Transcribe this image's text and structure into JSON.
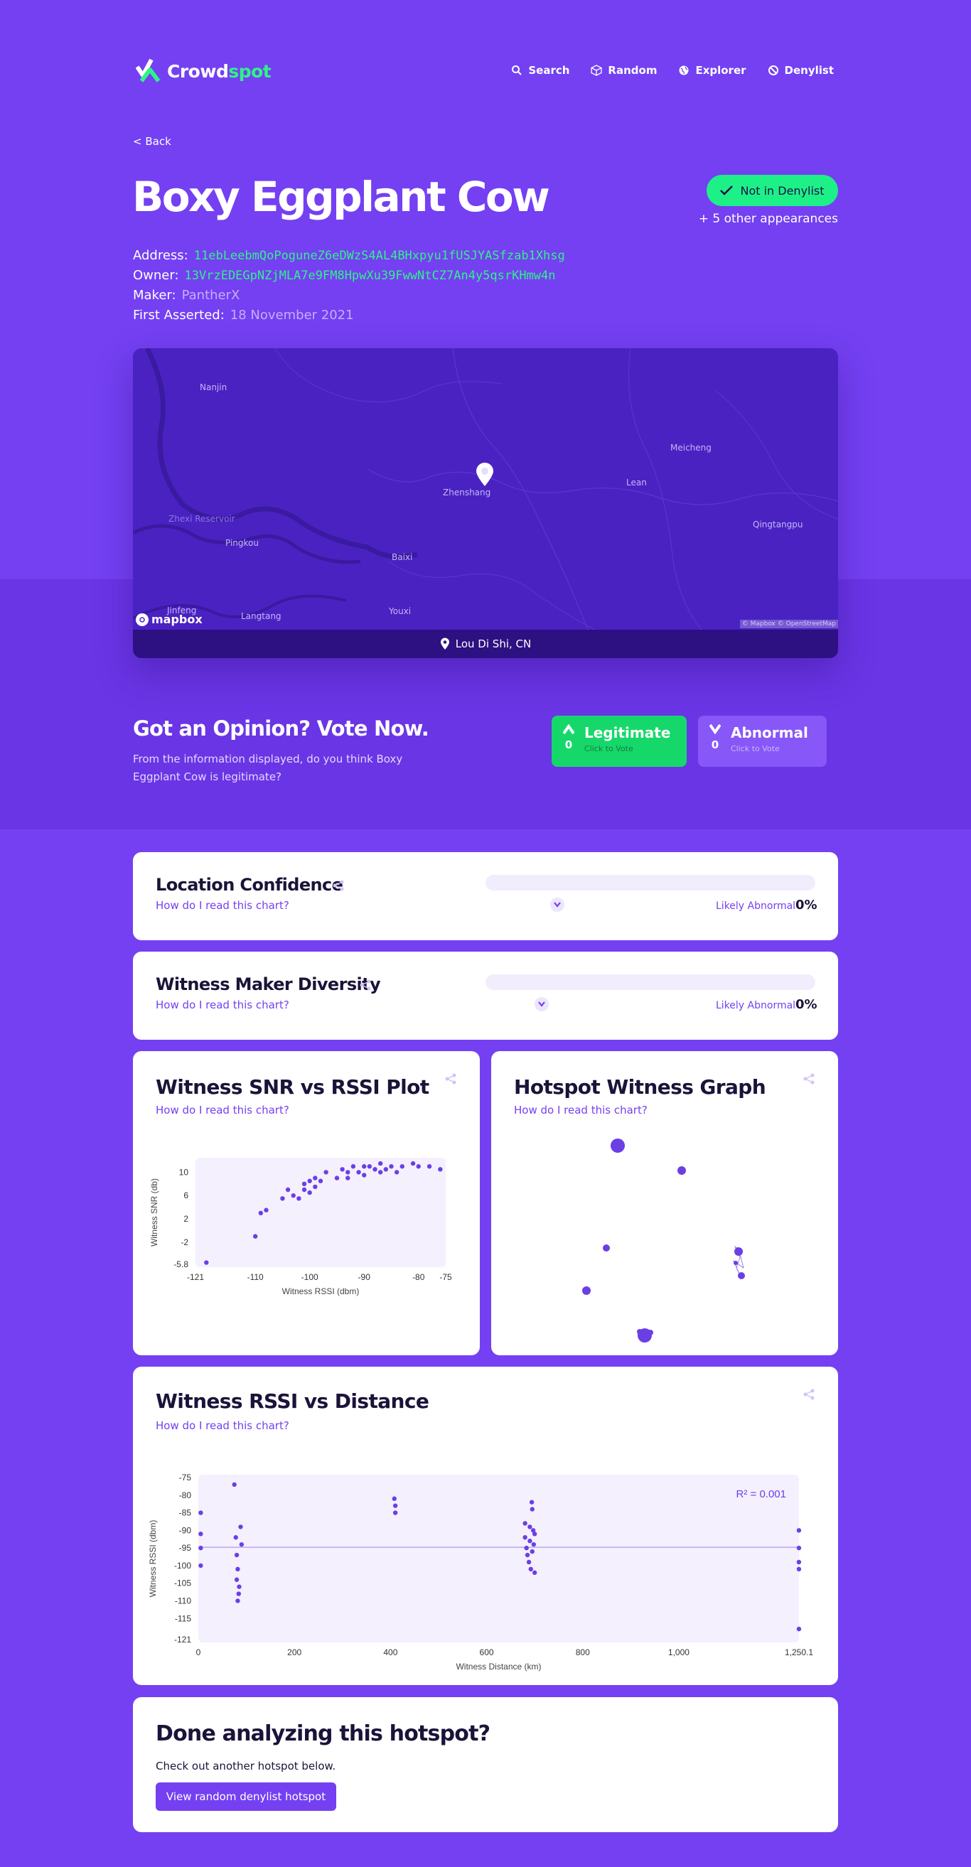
{
  "colors": {
    "brand": "#7440f2",
    "accent_green": "#1ef088",
    "card_bg": "#ffffff",
    "plot_bg": "#f4f0fe",
    "dot": "#6b3fe4"
  },
  "nav": {
    "logo_prefix": "Crowd",
    "logo_suffix": "spot",
    "links": [
      {
        "label": "Search",
        "icon": "search-icon"
      },
      {
        "label": "Random",
        "icon": "cube-icon"
      },
      {
        "label": "Explorer",
        "icon": "globe-icon"
      },
      {
        "label": "Denylist",
        "icon": "block-icon"
      }
    ]
  },
  "back_label": "< Back",
  "hotspot": {
    "name": "Boxy Eggplant Cow",
    "status": "Not in Denylist",
    "appearances": "+ 5 other appearances",
    "address_label": "Address:",
    "address": "11ebLeebmQoPoguneZ6eDWzS4AL4BHxpyu1fUSJYASfzab1Xhsg",
    "owner_label": "Owner:",
    "owner": "13VrzEDEGpNZjMLA7e9FM8HpwXu39FwwNtCZ7An4y5qsrKHmw4n",
    "maker_label": "Maker:",
    "maker": "PantherX",
    "asserted_label": "First Asserted:",
    "asserted": "18 November 2021"
  },
  "map": {
    "places": [
      "Nanjin",
      "Meicheng",
      "Zhenshang",
      "Lean",
      "Zhexi Reservoir",
      "Qingtangpu",
      "Pingkou",
      "Baixi",
      "Jinfeng",
      "Langtang",
      "Youxi"
    ],
    "brand": "mapbox",
    "attribution": "© Mapbox © OpenStreetMap",
    "location": "Lou Di Shi, CN"
  },
  "vote": {
    "title": "Got an Opinion? Vote Now.",
    "description": "From the information displayed, do you think Boxy Eggplant Cow is legitimate?",
    "legit": {
      "label": "Legitimate",
      "count": "0",
      "sub": "Click to Vote"
    },
    "abnormal": {
      "label": "Abnormal",
      "count": "0",
      "sub": "Click to Vote"
    }
  },
  "help_link": "How do I read this chart?",
  "location_confidence": {
    "title": "Location Confidence",
    "likely": "Likely Abnormal",
    "percent": "0%",
    "level": 0
  },
  "witness_diversity": {
    "title": "Witness Maker Diversity",
    "likely": "Likely Abnormal",
    "percent": "0%",
    "level": 0
  },
  "snr_plot": {
    "title": "Witness SNR vs RSSI Plot"
  },
  "witness_graph": {
    "title": "Hotspot Witness Graph"
  },
  "rssi_distance": {
    "title": "Witness RSSI vs Distance"
  },
  "done": {
    "title": "Done analyzing this hotspot?",
    "sub": "Check out another hotspot below.",
    "button": "View random denylist hotspot"
  },
  "chart_data": [
    {
      "type": "scatter",
      "title": "Witness SNR vs RSSI Plot",
      "xlabel": "Witness RSSI (dbm)",
      "ylabel": "Witness SNR (db)",
      "xlim": [
        -121,
        -75
      ],
      "ylim": [
        -5.8,
        12
      ],
      "xticks": [
        "-121",
        "-110",
        "-100",
        "-90",
        "-80",
        "-75"
      ],
      "yticks": [
        "10",
        "6",
        "2",
        "-2",
        "-5.8"
      ],
      "x": [
        -119,
        -110,
        -109,
        -108,
        -105,
        -104,
        -103,
        -102,
        -101,
        -101,
        -100,
        -100,
        -99,
        -99,
        -98,
        -97,
        -95,
        -94,
        -93,
        -93,
        -92,
        -91,
        -90,
        -90,
        -89,
        -88,
        -87,
        -87,
        -86,
        -85,
        -84,
        -83,
        -81,
        -80,
        -78,
        -76
      ],
      "y": [
        -5.5,
        -1,
        3,
        3.5,
        5.5,
        7,
        6,
        5.5,
        8,
        7,
        8.5,
        6.5,
        9,
        7.5,
        8.5,
        10,
        9,
        10.5,
        10,
        9,
        11,
        10,
        11,
        9.5,
        11,
        10.5,
        11.5,
        10,
        10.5,
        11,
        10,
        11,
        11.5,
        11,
        11,
        10.5
      ]
    },
    {
      "type": "scatter",
      "title": "Witness RSSI vs Distance",
      "xlabel": "Witness Distance (km)",
      "ylabel": "Witness RSSI (dbm)",
      "annotation": "R² = 0.001",
      "xlim": [
        0,
        1250.1
      ],
      "ylim": [
        -121,
        -75
      ],
      "xticks": [
        "0",
        "200",
        "400",
        "600",
        "800",
        "1,000",
        "1,250.1"
      ],
      "yticks": [
        "-75",
        "-80",
        "-85",
        "-90",
        "-95",
        "-100",
        "-105",
        "-110",
        "-115",
        "-121"
      ],
      "x": [
        5,
        5,
        5,
        5,
        75,
        78,
        80,
        82,
        80,
        85,
        84,
        82,
        90,
        88,
        408,
        410,
        410,
        680,
        680,
        683,
        685,
        688,
        690,
        690,
        692,
        694,
        695,
        695,
        697,
        698,
        700,
        700,
        1250,
        1250,
        1250,
        1250,
        1250
      ],
      "y": [
        -85,
        -91,
        -95,
        -100,
        -77,
        -92,
        -97,
        -101,
        -104,
        -106,
        -108,
        -110,
        -94,
        -89,
        -81,
        -83,
        -85,
        -88,
        -92,
        -95,
        -97,
        -99,
        -89,
        -93,
        -101,
        -82,
        -84,
        -96,
        -90,
        -94,
        -102,
        -91,
        -90,
        -95,
        -99,
        -101,
        -118
      ],
      "trend_y": -94.8
    }
  ]
}
